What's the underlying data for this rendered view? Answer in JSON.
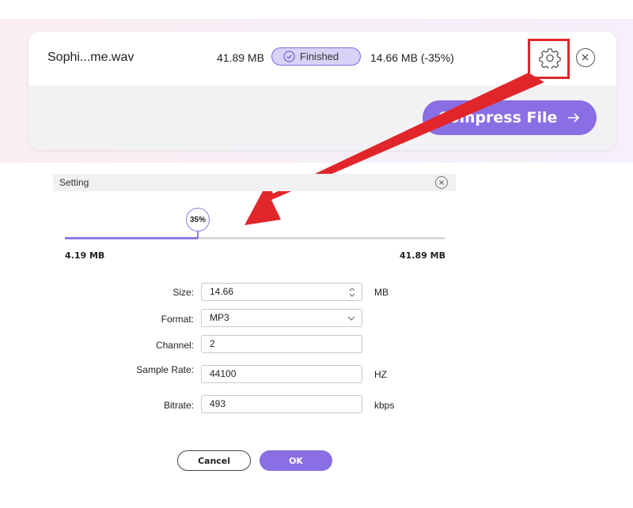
{
  "file": {
    "name": "Sophi...me.wav",
    "original_size": "41.89 MB",
    "status": "Finished",
    "compressed_size": "14.66 MB (-35%)"
  },
  "compress_button": {
    "label": "Compress File"
  },
  "setting": {
    "title": "Setting",
    "slider": {
      "percent_label": "35%",
      "value_fraction": 0.35,
      "min_label": "4.19 MB",
      "max_label": "41.89 MB"
    },
    "fields": {
      "size": {
        "label": "Size:",
        "value": "14.66",
        "unit": "MB"
      },
      "format": {
        "label": "Format:",
        "value": "MP3"
      },
      "channel": {
        "label": "Channel:",
        "value": "2"
      },
      "sample_rate": {
        "label": "Sample Rate:",
        "value": "44100",
        "unit": "HZ"
      },
      "bitrate": {
        "label": "Bitrate:",
        "value": "493",
        "unit": "kbps"
      }
    },
    "cancel_label": "Cancel",
    "ok_label": "OK"
  },
  "icons": {
    "status": "check-circle-icon",
    "settings": "gear-icon",
    "close": "close-icon",
    "arrow": "arrow-right-icon",
    "stepper": "stepper-icon",
    "dropdown": "chevron-down-icon"
  },
  "colors": {
    "accent": "#8a6ee3",
    "status_fill": "#d9d2f7",
    "highlight": "#e0262a",
    "slider_track": "#d8d8d8"
  }
}
